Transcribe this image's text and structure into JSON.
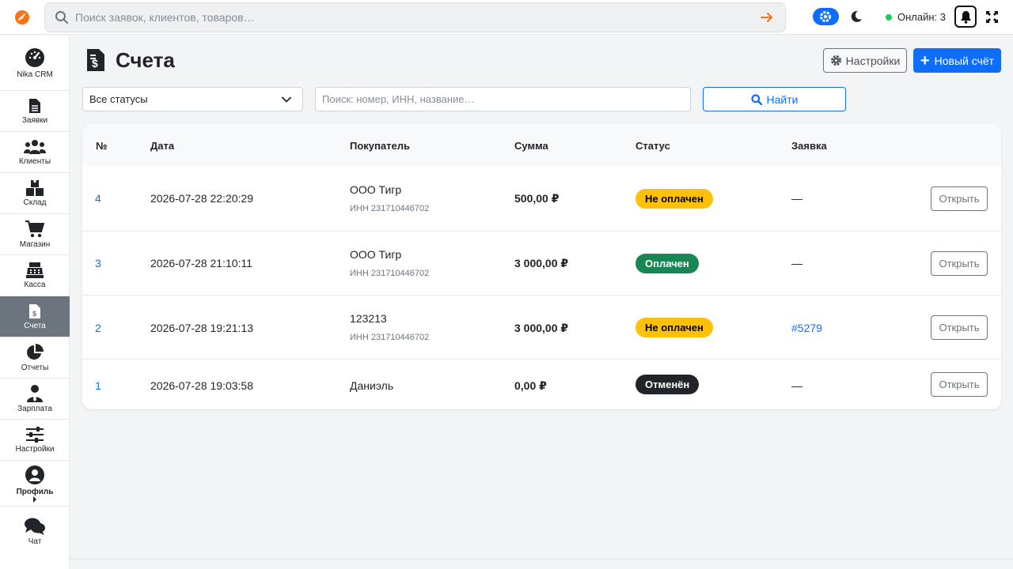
{
  "topbar": {
    "search_placeholder": "Поиск заявок, клиентов, товаров…",
    "online_label": "Онлайн: 3",
    "accent_color": "#0d6efd"
  },
  "sidebar": {
    "items": [
      {
        "label": "Nika CRM",
        "icon": "gauge-icon"
      },
      {
        "label": "Заявки",
        "icon": "file-icon"
      },
      {
        "label": "Клиенты",
        "icon": "users-icon"
      },
      {
        "label": "Склад",
        "icon": "boxes-icon"
      },
      {
        "label": "Магазин",
        "icon": "cart-icon"
      },
      {
        "label": "Касса",
        "icon": "cash-register-icon"
      },
      {
        "label": "Счета",
        "icon": "invoice-icon",
        "active": true
      },
      {
        "label": "Отчеты",
        "icon": "pie-chart-icon"
      },
      {
        "label": "Зарплата",
        "icon": "user-tie-icon"
      },
      {
        "label": "Настройки",
        "icon": "sliders-icon"
      },
      {
        "label": "Профиль",
        "icon": "user-circle-icon"
      },
      {
        "label": "Чат",
        "icon": "comments-icon"
      }
    ]
  },
  "page": {
    "title": "Счета",
    "settings_label": "Настройки",
    "new_label": "Новый счёт"
  },
  "filters": {
    "status_selected": "Все статусы",
    "search_placeholder": "Поиск: номер, ИНН, название…",
    "find_label": "Найти"
  },
  "table": {
    "headers": [
      "№",
      "Дата",
      "Покупатель",
      "Сумма",
      "Статус",
      "Заявка"
    ],
    "open_label": "Открыть",
    "rows": [
      {
        "num": "4",
        "date": "2026-07-28 22:20:29",
        "buyer": "ООО Тигр",
        "inn": "ИНН 231710446702",
        "amount": "500,00 ₽",
        "status": "Не оплачен",
        "status_type": "unpaid",
        "request": "—"
      },
      {
        "num": "3",
        "date": "2026-07-28 21:10:11",
        "buyer": "ООО Тигр",
        "inn": "ИНН 231710446702",
        "amount": "3 000,00 ₽",
        "status": "Оплачен",
        "status_type": "paid",
        "request": "—"
      },
      {
        "num": "2",
        "date": "2026-07-28 19:21:13",
        "buyer": "123213",
        "inn": "ИНН 231710446702",
        "amount": "3 000,00 ₽",
        "status": "Не оплачен",
        "status_type": "unpaid",
        "request": "#5279"
      },
      {
        "num": "1",
        "date": "2026-07-28 19:03:58",
        "buyer": "Даниэль",
        "inn": "",
        "amount": "0,00 ₽",
        "status": "Отменён",
        "status_type": "cancel",
        "request": "—"
      }
    ]
  }
}
